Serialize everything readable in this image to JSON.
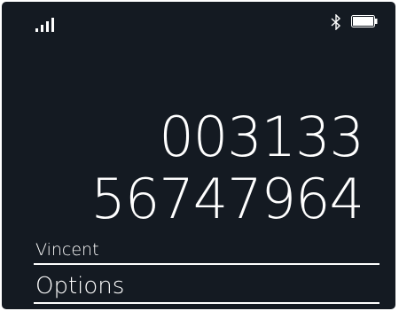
{
  "status_bar": {
    "signal_icon": "signal-bars-icon",
    "signal_bars": 4,
    "bluetooth_icon": "bluetooth-icon",
    "battery_icon": "battery-icon",
    "battery_level": 1.0
  },
  "dialer": {
    "number_line1": "003133",
    "number_line2": "56747964",
    "contact_name": "Vincent"
  },
  "menu": {
    "options_label": "Options"
  },
  "colors": {
    "screen_background": "#141a22",
    "text": "#ffffff"
  }
}
